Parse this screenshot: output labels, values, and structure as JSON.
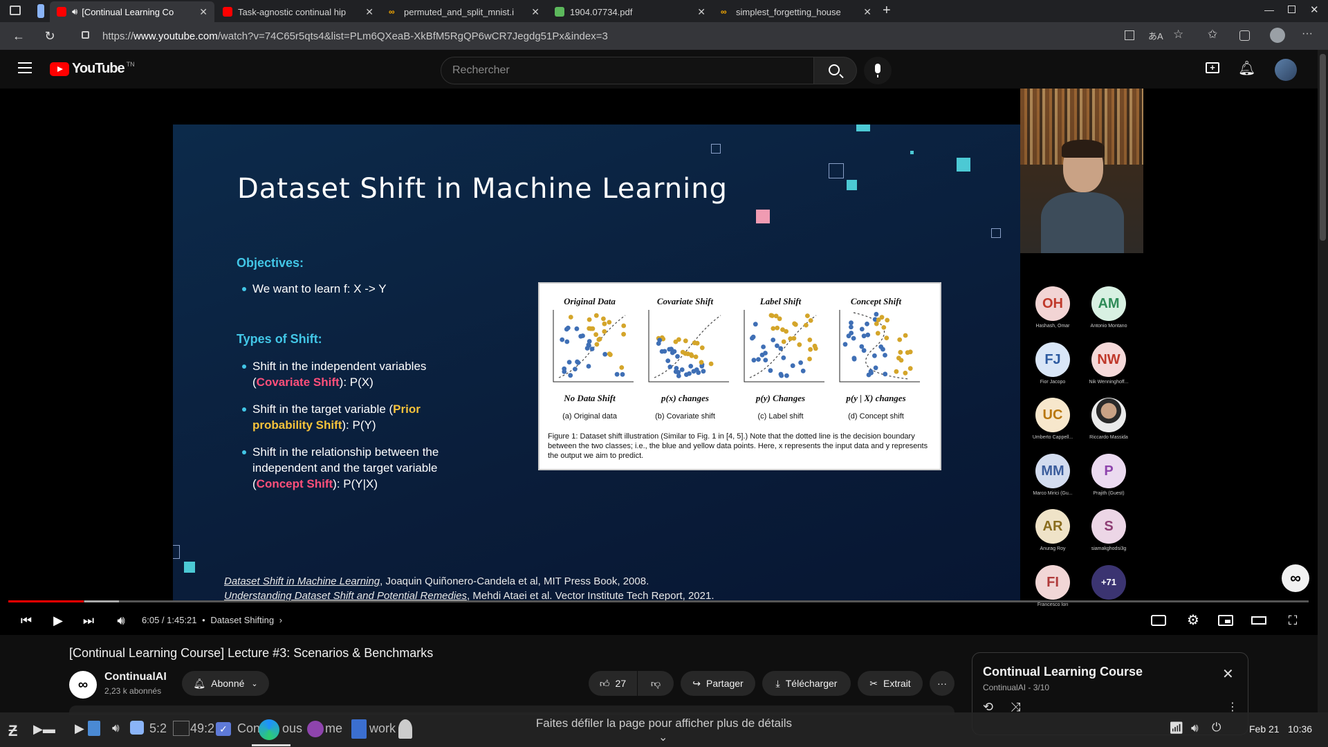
{
  "browser": {
    "tabs": [
      {
        "title": "[Continual Learning Co",
        "icon": "youtube-icon",
        "active": true
      },
      {
        "title": "Task-agnostic continual hip",
        "icon": "youtube-icon",
        "active": false
      },
      {
        "title": "permuted_and_split_mnist.i",
        "icon": "colab-icon",
        "active": false
      },
      {
        "title": "1904.07734.pdf",
        "icon": "pdf-icon",
        "active": false
      },
      {
        "title": "simplest_forgetting_house",
        "icon": "colab-icon",
        "active": false
      }
    ],
    "url_prefix": "https://",
    "url_host": "www.youtube.com",
    "url_path": "/watch?v=74C65r5qts4&list=PLm6QXeaB-XkBfM5RgQP6wCR7Jegdg51Px&index=3"
  },
  "youtube": {
    "logo_text": "YouTube",
    "logo_region": "TN",
    "search_placeholder": "Rechercher"
  },
  "slide": {
    "title": "Dataset Shift in Machine Learning",
    "objectives_heading": "Objectives:",
    "objective_1": "We want to learn f: X -> Y",
    "types_heading": "Types of Shift:",
    "shift1_a": "Shift in the independent variables",
    "shift1_open": "(",
    "shift1_term": "Covariate Shift",
    "shift1_close": "): P(X)",
    "shift2_a": "Shift in the target variable (",
    "shift2_term1": "Prior",
    "shift2_term2": "probability Shift",
    "shift2_close": "): P(Y)",
    "shift3_a": "Shift in the relationship between the",
    "shift3_b": "independent and the target variable",
    "shift3_open": "(",
    "shift3_term": "Concept Shift",
    "shift3_close": "): P(Y|X)",
    "figure": {
      "panels": [
        {
          "title": "Original Data",
          "sub": "No Data Shift",
          "cap": "(a) Original data"
        },
        {
          "title": "Covariate Shift",
          "sub": "p(x) changes",
          "cap": "(b) Covariate shift"
        },
        {
          "title": "Label Shift",
          "sub": "p(y) Changes",
          "cap": "(c) Label shift"
        },
        {
          "title": "Concept Shift",
          "sub": "p(y | X) changes",
          "cap": "(d) Concept shift"
        }
      ],
      "caption": "Figure 1: Dataset shift illustration (Similar to Fig. 1 in [4, 5].) Note that the dotted line is the decision boundary between the two classes; i.e., the blue and yellow data points. Here, x represents the input data and y represents the output we aim to predict."
    },
    "ref1_link": "Dataset Shift in Machine Learning",
    "ref1_rest": ", Joaquin Quiñonero-Candela et al, MIT Press Book, 2008.",
    "ref2_link": "Understanding Dataset Shift and Potential Remedies",
    "ref2_rest": ", Mehdi Ataei et al. Vector Institute Tech Report, 2021."
  },
  "participants": [
    {
      "initials": "OH",
      "name": "Hashash, Omar",
      "color": "#f2d4d4",
      "fg": "#c0392b"
    },
    {
      "initials": "AM",
      "name": "Antonio Montano",
      "color": "#d8f0e2",
      "fg": "#2e8b57"
    },
    {
      "initials": "FJ",
      "name": "Fior Jacopo",
      "color": "#d9e6f7",
      "fg": "#2c5aa0"
    },
    {
      "initials": "NW",
      "name": "Nik Wenninghoff...",
      "color": "#f5d9d9",
      "fg": "#c0392b"
    },
    {
      "initials": "UC",
      "name": "Umberto Cappell...",
      "color": "#f7e7cc",
      "fg": "#b9770e"
    },
    {
      "initials": "",
      "name": "Riccardo Massida",
      "color": "#e6e6e6",
      "fg": "#333"
    },
    {
      "initials": "MM",
      "name": "Marco Mirici (Gu...",
      "color": "#d3dcef",
      "fg": "#3b5d9c"
    },
    {
      "initials": "P",
      "name": "Prajith (Guest)",
      "color": "#ebdaf0",
      "fg": "#8e44ad"
    },
    {
      "initials": "AR",
      "name": "Anurag Roy",
      "color": "#efe3c8",
      "fg": "#8a6d1e"
    },
    {
      "initials": "S",
      "name": "siamakghodsi3g",
      "color": "#ecd6e6",
      "fg": "#8e3e74"
    },
    {
      "initials": "FI",
      "name": "Francesco Iori",
      "color": "#f1d6d6",
      "fg": "#b03a3a"
    },
    {
      "initials": "+71",
      "name": "",
      "color": "#3b3471",
      "fg": "#fff"
    }
  ],
  "player": {
    "progress": 0.058,
    "time": "6:05 / 1:45:21",
    "chapter": "Dataset Shifting"
  },
  "video": {
    "title": "[Continual Learning Course] Lecture #3: Scenarios & Benchmarks",
    "channel": "ContinualAI",
    "subscribers": "2,23 k abonnés",
    "subscribed_label": "Abonné",
    "likes": "27",
    "share_label": "Partager",
    "download_label": "Télécharger",
    "clip_label": "Extrait"
  },
  "playlist": {
    "title": "Continual Learning Course",
    "meta": "ContinualAI - 3/10"
  },
  "taskbar": {
    "scroll_hint": "Faites défiler la page pour afficher plus de détails",
    "time_overlap": "5:2",
    "time_overlap2": "49:2",
    "window_title_fragment": "Con",
    "window_title_fragment2": "ous",
    "window_title_fragment3": "me",
    "window_title_fragment4": "work",
    "date": "Feb 21",
    "clock": "10:36"
  }
}
